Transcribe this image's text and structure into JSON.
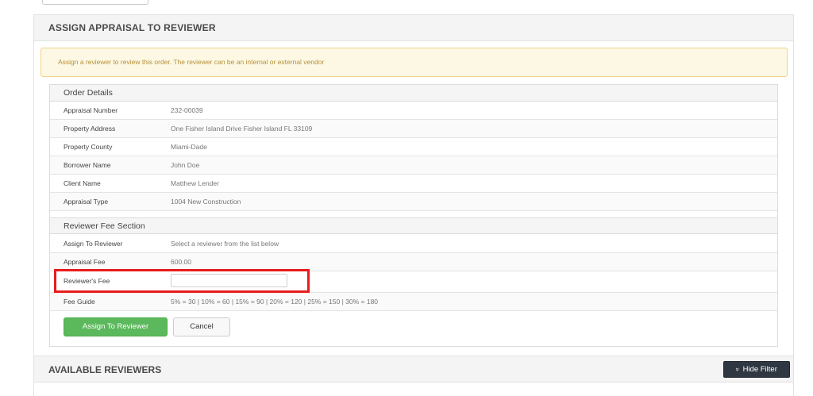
{
  "page": {
    "title": "ASSIGN APPRAISAL TO REVIEWER",
    "alert": "Assign a reviewer to review this order. The reviewer can be an internal or external vendor"
  },
  "order_details": {
    "heading": "Order Details",
    "rows": [
      {
        "label": "Appraisal Number",
        "value": "232-00039"
      },
      {
        "label": "Property Address",
        "value": "One Fisher Island Drive Fisher Island FL 33109"
      },
      {
        "label": "Property County",
        "value": "Miami-Dade"
      },
      {
        "label": "Borrower Name",
        "value": "John Doe"
      },
      {
        "label": "Client Name",
        "value": "Matthew Lender"
      },
      {
        "label": "Appraisal Type",
        "value": "1004 New Construction"
      }
    ]
  },
  "reviewer_fee": {
    "heading": "Reviewer Fee Section",
    "assign_label": "Assign To Reviewer",
    "assign_value": "Select a reviewer from the list below",
    "appraisal_fee_label": "Appraisal Fee",
    "appraisal_fee_value": "600.00",
    "reviewers_fee_label": "Reviewer's Fee",
    "reviewers_fee_value": "",
    "fee_guide_label": "Fee Guide",
    "fee_guide_value": "5% = 30 | 10% = 60 | 15% = 90 | 20% = 120 | 25% = 150 | 30% = 180"
  },
  "actions": {
    "assign_button": "Assign To Reviewer",
    "cancel_button": "Cancel"
  },
  "available_reviewers": {
    "title": "AVAILABLE REVIEWERS",
    "hide_filter_icon": "double-chevron-down-icon",
    "hide_filter_label": "Hide Filter"
  },
  "colors": {
    "primary_button": "#5cb85c",
    "highlight": "#e81c1c",
    "alert_bg": "#fcf8e3",
    "dark_button": "#2f3842"
  }
}
